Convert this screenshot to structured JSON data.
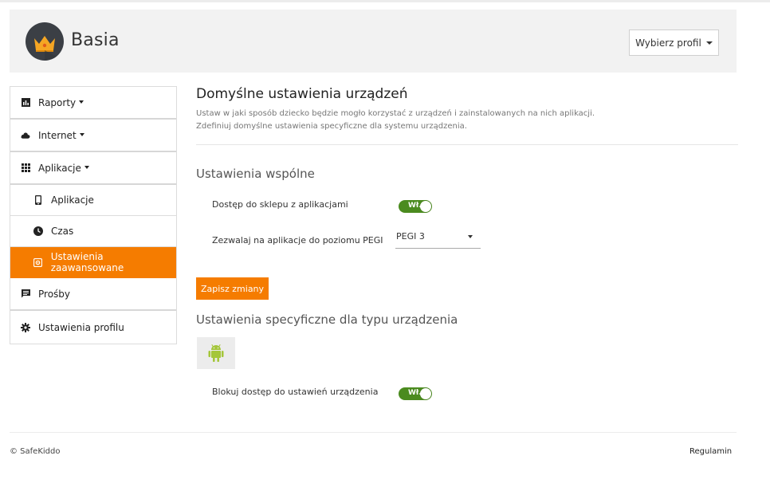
{
  "header": {
    "profile_name": "Basia",
    "profile_button_label": "Wybierz profil"
  },
  "sidebar": {
    "items": [
      {
        "label": "Raporty",
        "icon": "bar-chart-icon"
      },
      {
        "label": "Internet",
        "icon": "cloud-icon"
      },
      {
        "label": "Aplikacje",
        "icon": "grid-icon"
      },
      {
        "label": "Aplikacje",
        "icon": "smartphone-icon"
      },
      {
        "label": "Czas",
        "icon": "clock-icon"
      },
      {
        "label": "Ustawienia zaawansowane",
        "icon": "settings-chip-icon",
        "active": true
      },
      {
        "label": "Prośby",
        "icon": "message-icon"
      },
      {
        "label": "Ustawienia profilu",
        "icon": "gear-icon"
      }
    ]
  },
  "main": {
    "title": "Domyślne ustawienia urządzeń",
    "description_line1": "Ustaw w jaki sposób dziecko będzie mogło korzystać z urządzeń i zainstalowanych na nich aplikacji.",
    "description_line2": "Zdefiniuj domyślne ustawienia specyficzne dla systemu urządzenia.",
    "common_section_title": "Ustawienia wspólne",
    "store_access_label": "Dostęp do sklepu z aplikacjami",
    "store_access_toggle": "Wł.",
    "pegi_label": "Zezwalaj na aplikacje do poziomu PEGI",
    "pegi_value": "PEGI 3",
    "save_button": "Zapisz zmiany",
    "device_section_title": "Ustawienia specyficzne dla typu urządzenia",
    "device_type_icon": "android-icon",
    "block_settings_label": "Blokuj dostęp do ustawień urządzenia",
    "block_settings_toggle": "Wł."
  },
  "footer": {
    "copyright": "© SafeKiddo",
    "terms": "Regulamin"
  },
  "colors": {
    "accent": "#f57c00",
    "toggle_on": "#4b8b1f",
    "android": "#a4c639"
  }
}
